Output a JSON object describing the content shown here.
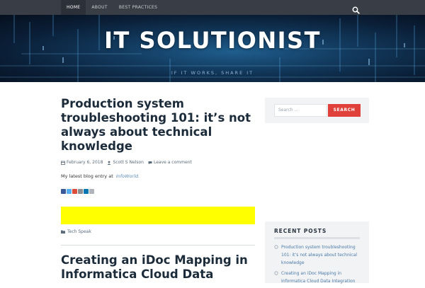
{
  "nav": {
    "items": [
      {
        "label": "HOME",
        "active": true
      },
      {
        "label": "ABOUT",
        "active": false
      },
      {
        "label": "BEST PRACTICES",
        "active": false
      }
    ],
    "search_icon": "search-icon"
  },
  "site": {
    "title": "IT SOLUTIONIST",
    "tagline": "IF IT WORKS, SHARE IT"
  },
  "posts": [
    {
      "title_lines": [
        "Production system",
        "troubleshooting 101: it’s not",
        "always about technical",
        "knowledge"
      ],
      "date": "February 6, 2018",
      "author": "Scott S Nelson",
      "comments": "Leave a comment",
      "excerpt": "My latest blog entry at",
      "excerpt_link": "InfoWorld.",
      "share_icons": [
        "facebook-icon",
        "twitter-icon",
        "google-plus-icon",
        "linkedin-icon",
        "email-icon"
      ],
      "category": "Tech Speak"
    },
    {
      "title_lines": [
        "Creating an iDoc Mapping in",
        "Informatica Cloud Data"
      ]
    }
  ],
  "sidebar": {
    "search_placeholder": "Search …",
    "search_button": "SEARCH",
    "recent_title": "RECENT POSTS",
    "recent_posts": [
      "Production system troubleshooting 101: it’s not always about technical knowledge",
      "Creating an iDoc Mapping in Informatica Cloud Data Integration"
    ]
  },
  "colors": {
    "nav_bg": "#393e46",
    "accent_red": "#e0403a",
    "title_text": "#1c2b3a",
    "link_blue": "#4a78a6",
    "ad_yellow": "#ffff00"
  }
}
